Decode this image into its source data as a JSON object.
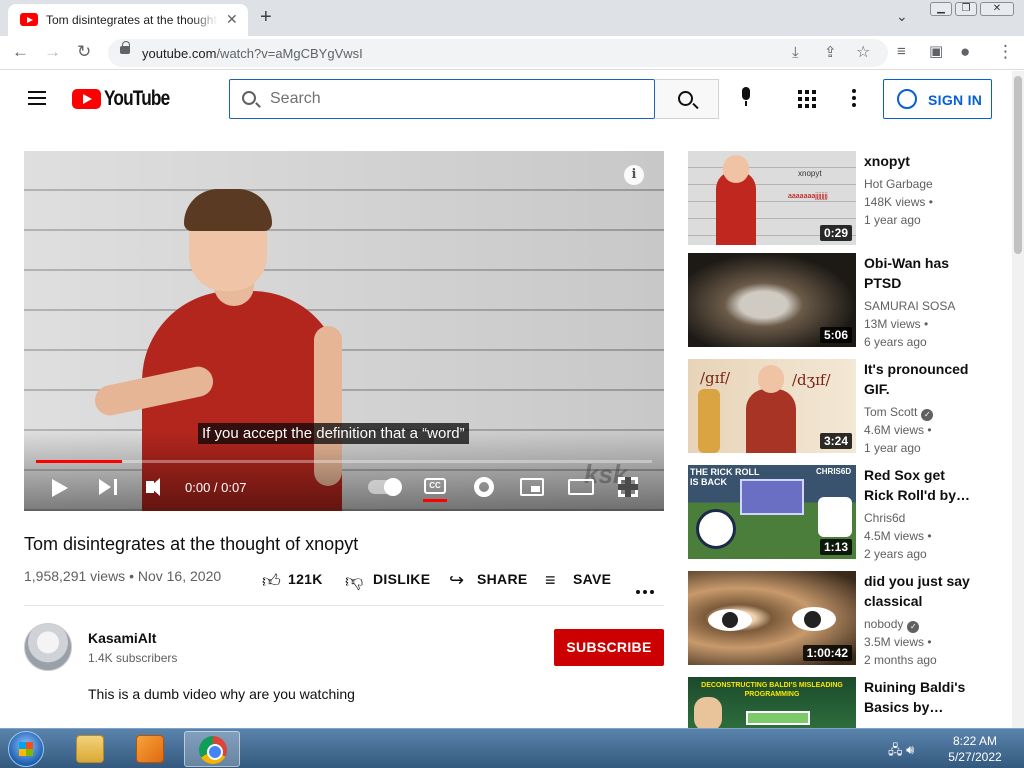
{
  "browser": {
    "tab_title": "Tom disintegrates at the thought of xnopyt",
    "tab_close": "✕",
    "new_tab": "+",
    "url_host": "youtube.com",
    "url_path": "/watch?v=aMgCBYgVwsI"
  },
  "header": {
    "logo_text": "YouTube",
    "search_placeholder": "Search",
    "signin_label": "SIGN IN"
  },
  "player": {
    "caption": "If you accept the definition that a “word”",
    "watermark": "ksk",
    "time": "0:00 / 0:07",
    "progress_fraction": 0.14,
    "cc_label": "CC",
    "info": "i"
  },
  "video": {
    "title": "Tom disintegrates at the thought of xnopyt",
    "stats": "1,958,291 views • Nov 16, 2020",
    "like_count": "121K",
    "dislike_label": "DISLIKE",
    "share_label": "SHARE",
    "save_label": "SAVE"
  },
  "channel": {
    "name": "KasamiAlt",
    "subscribers": "1.4K subscribers",
    "subscribe_label": "SUBSCRIBE",
    "description": "This is a dumb video why are you watching"
  },
  "recommendations": [
    {
      "title": "xnopyt",
      "channel": "Hot Garbage",
      "verified": false,
      "views": "148K views •",
      "age": "1 year ago",
      "duration": "0:29"
    },
    {
      "title": "Obi-Wan has PTSD",
      "channel": "SAMURAI SOSA",
      "verified": false,
      "views": "13M views •",
      "age": "6 years ago",
      "duration": "5:06"
    },
    {
      "title": "It's pronounced GIF.",
      "channel": "Tom Scott",
      "verified": true,
      "views": "4.6M views •",
      "age": "1 year ago",
      "duration": "3:24"
    },
    {
      "title": "Red Sox get Rick Roll'd by…",
      "channel": "Chris6d",
      "verified": false,
      "views": "4.5M views •",
      "age": "2 years ago",
      "duration": "1:13"
    },
    {
      "title": "did you just say classical musi…",
      "channel": "nobody",
      "verified": true,
      "views": "3.5M views •",
      "age": "2 months ago",
      "duration": "1:00:42"
    },
    {
      "title": "Ruining Baldi's Basics by…",
      "channel": "",
      "verified": false,
      "views": "",
      "age": "",
      "duration": ""
    }
  ],
  "thumb_text": {
    "t1_label": "xnopyt",
    "t1_sub": "aaaaaaajjjjjjjj",
    "t3_left": "/gɪf/",
    "t3_right": "/dʒɪf/",
    "t4_top": "THE RICK ROLL IS BACK",
    "t4_right": "CHRIS6D",
    "t6_banner": "DECONSTRUCTING BALDI'S MISLEADING PROGRAMMING"
  },
  "taskbar": {
    "time": "8:22 AM",
    "date": "5/27/2022"
  },
  "colors": {
    "yt_red": "#ff0000",
    "subscribe_red": "#cc0000",
    "link_blue": "#065fd4"
  }
}
